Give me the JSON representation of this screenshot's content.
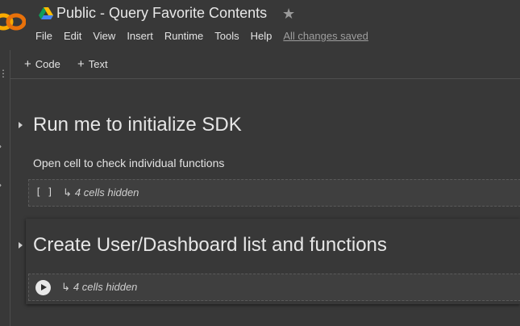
{
  "header": {
    "title": "Public - Query Favorite Contents",
    "star_icon": "star-icon",
    "logo_icon": "colab-logo",
    "drive_icon": "google-drive-icon",
    "menu": [
      "File",
      "Edit",
      "View",
      "Insert",
      "Runtime",
      "Tools",
      "Help"
    ],
    "save_status": "All changes saved"
  },
  "toolbar": {
    "add_code": "Code",
    "add_text": "Text"
  },
  "sections": [
    {
      "title": "Run me to initialize SDK",
      "description": "Open cell to check individual functions",
      "cell_prompt": "[ ]",
      "hidden": "4 cells hidden"
    },
    {
      "title": "Create User/Dashboard list and functions",
      "hidden": "4 cells hidden"
    }
  ],
  "colors": {
    "background": "#383838",
    "cell": "#3f3f3f",
    "logo_orange": "#F9AB00"
  }
}
